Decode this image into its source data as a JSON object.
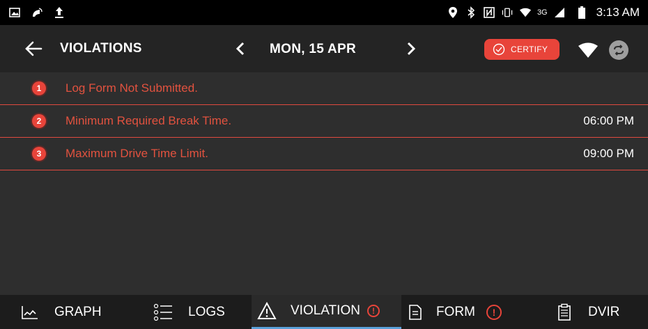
{
  "status_bar": {
    "time": "3:13 AM",
    "network": "3G",
    "icons": [
      "image-icon",
      "cast-icon",
      "upload-icon",
      "location-icon",
      "bluetooth-icon",
      "nfc-icon",
      "vibrate-icon",
      "wifi-icon",
      "signal-icon",
      "battery-icon"
    ]
  },
  "toolbar": {
    "title": "VIOLATIONS",
    "date": "MON, 15 APR",
    "certify_label": "CERTIFY",
    "accent_color": "#e8443a"
  },
  "violations": [
    {
      "number": "1",
      "description": "Log Form Not Submitted.",
      "time": ""
    },
    {
      "number": "2",
      "description": "Minimum Required Break Time.",
      "time": "06:00 PM"
    },
    {
      "number": "3",
      "description": "Maximum Drive Time Limit.",
      "time": "09:00 PM"
    }
  ],
  "tabs": {
    "graph": "GRAPH",
    "logs": "LOGS",
    "violation": "VIOLATION",
    "form": "FORM",
    "dvir": "DVIR",
    "active": "VIOLATION",
    "alert_symbol": "!"
  }
}
